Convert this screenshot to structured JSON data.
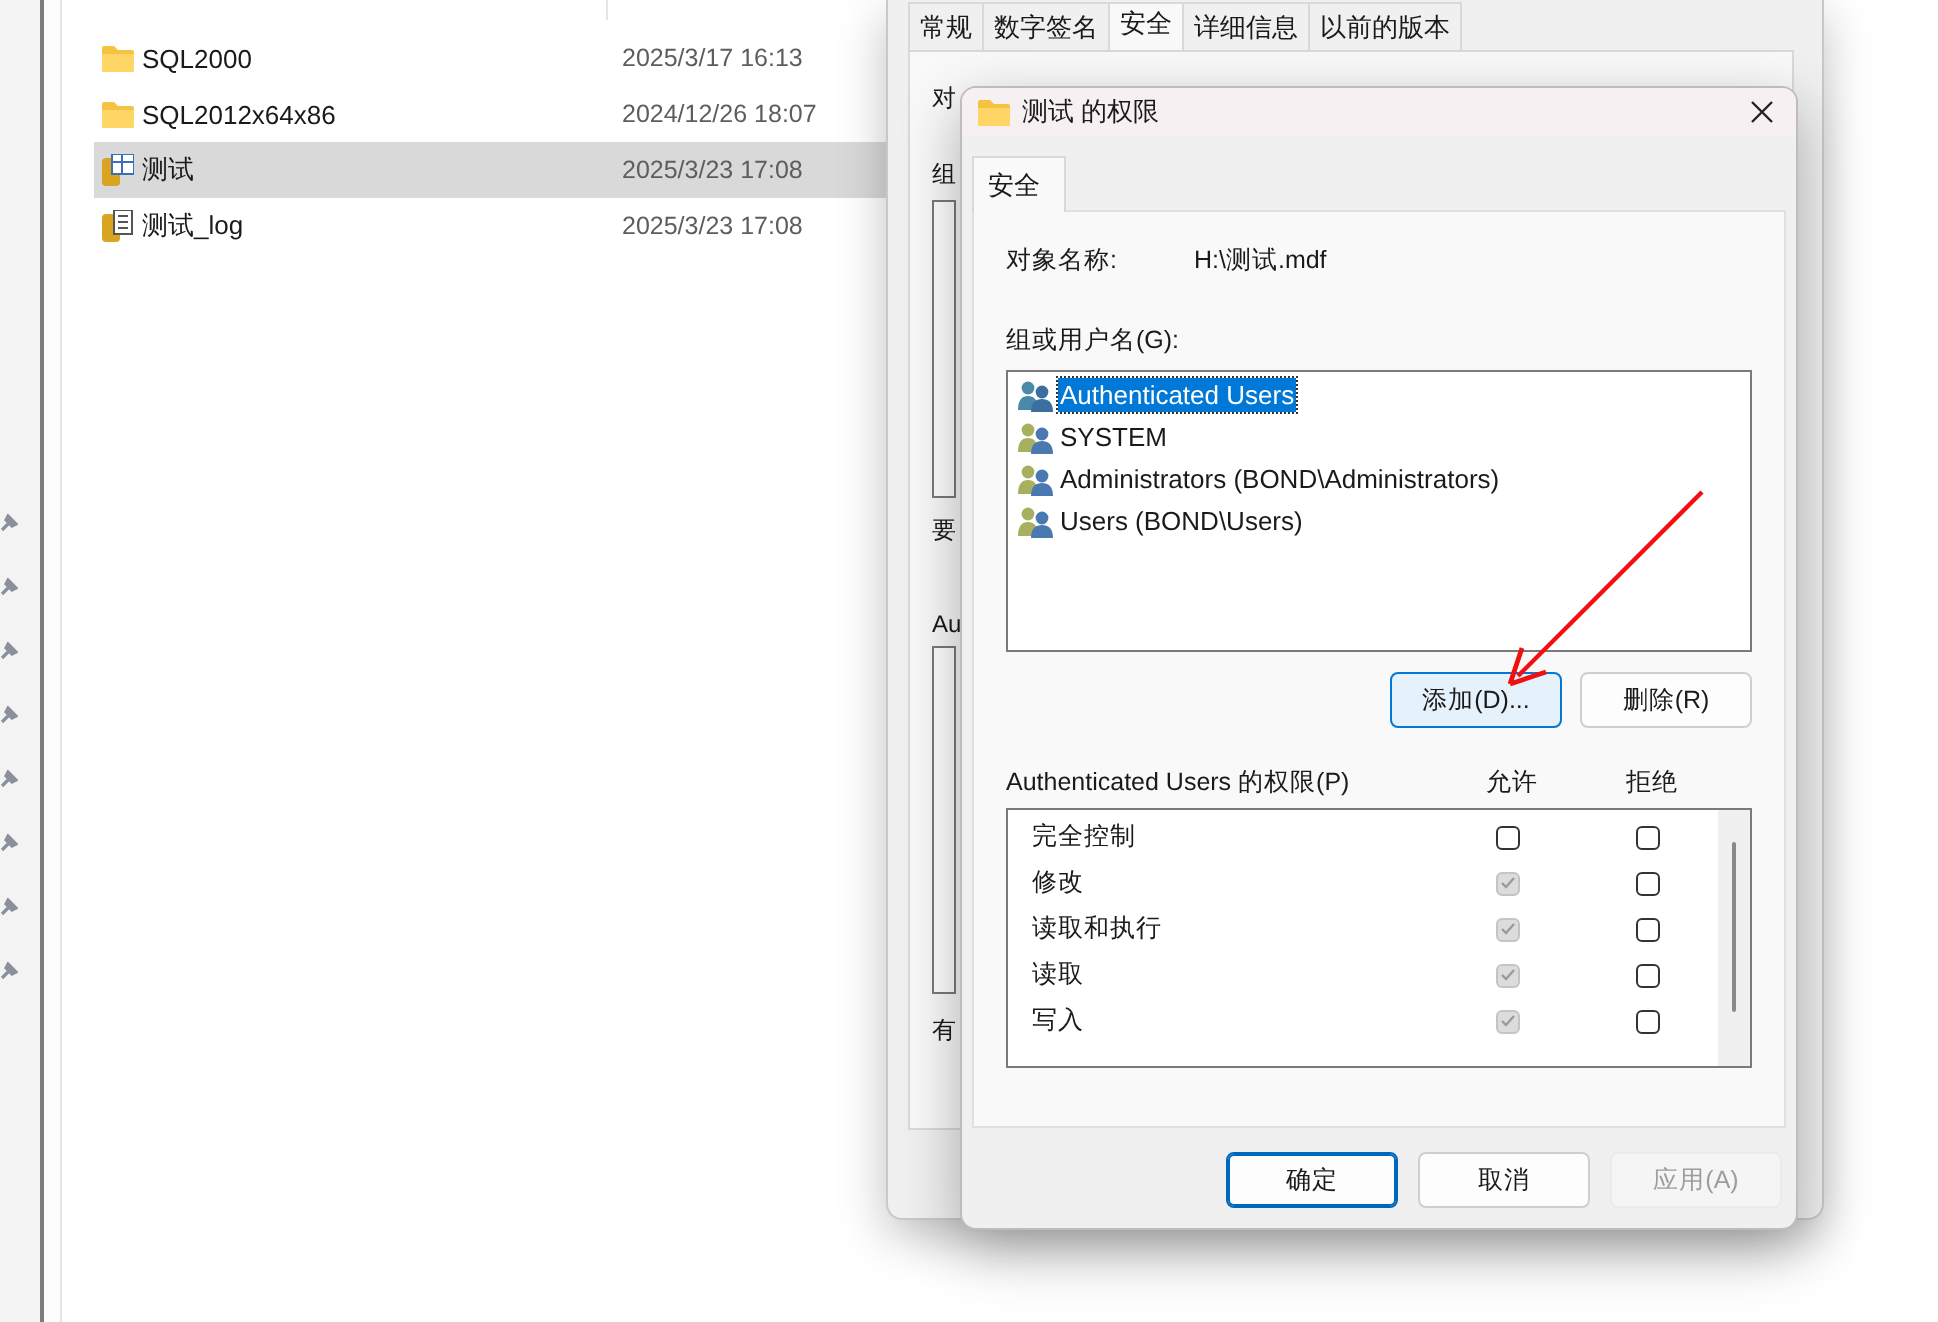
{
  "explorer": {
    "files": [
      {
        "name": "SQL2000",
        "date": "2025/3/17 16:13",
        "kind": "folder",
        "selected": false
      },
      {
        "name": "SQL2012x64x86",
        "date": "2024/12/26 18:07",
        "kind": "folder",
        "selected": false
      },
      {
        "name": "测试",
        "date": "2025/3/23 17:08",
        "kind": "database",
        "selected": true
      },
      {
        "name": "测试_log",
        "date": "2025/3/23 17:08",
        "kind": "log",
        "selected": false
      }
    ]
  },
  "properties_window": {
    "tabs": [
      {
        "label": "常规",
        "selected": false
      },
      {
        "label": "数字签名",
        "selected": false
      },
      {
        "label": "安全",
        "selected": true
      },
      {
        "label": "详细信息",
        "selected": false
      },
      {
        "label": "以前的版本",
        "selected": false
      }
    ],
    "partial_labels": [
      "对",
      "组",
      "要",
      "Au",
      "有"
    ]
  },
  "permissions_dialog": {
    "title": "测试 的权限",
    "tab": "安全",
    "object_label": "对象名称:",
    "object_value": "H:\\测试.mdf",
    "group_label": "组或用户名(G):",
    "principals": [
      {
        "name": "Authenticated Users",
        "kind": "group",
        "selected": true
      },
      {
        "name": "SYSTEM",
        "kind": "user",
        "selected": false
      },
      {
        "name": "Administrators (BOND\\Administrators)",
        "kind": "user",
        "selected": false
      },
      {
        "name": "Users (BOND\\Users)",
        "kind": "user",
        "selected": false
      }
    ],
    "add_button": "添加(D)...",
    "remove_button": "删除(R)",
    "permissions_label": "Authenticated Users 的权限(P)",
    "allow_header": "允许",
    "deny_header": "拒绝",
    "permissions": [
      {
        "name": "完全控制",
        "allow": false,
        "allow_disabled": false,
        "deny": false
      },
      {
        "name": "修改",
        "allow": true,
        "allow_disabled": true,
        "deny": false
      },
      {
        "name": "读取和执行",
        "allow": true,
        "allow_disabled": true,
        "deny": false
      },
      {
        "name": "读取",
        "allow": true,
        "allow_disabled": true,
        "deny": false
      },
      {
        "name": "写入",
        "allow": true,
        "allow_disabled": true,
        "deny": false
      }
    ],
    "buttons": [
      {
        "label": "确定",
        "kind": "default",
        "disabled": false
      },
      {
        "label": "取消",
        "kind": "normal",
        "disabled": false
      },
      {
        "label": "应用(A)",
        "kind": "normal",
        "disabled": true
      }
    ]
  }
}
